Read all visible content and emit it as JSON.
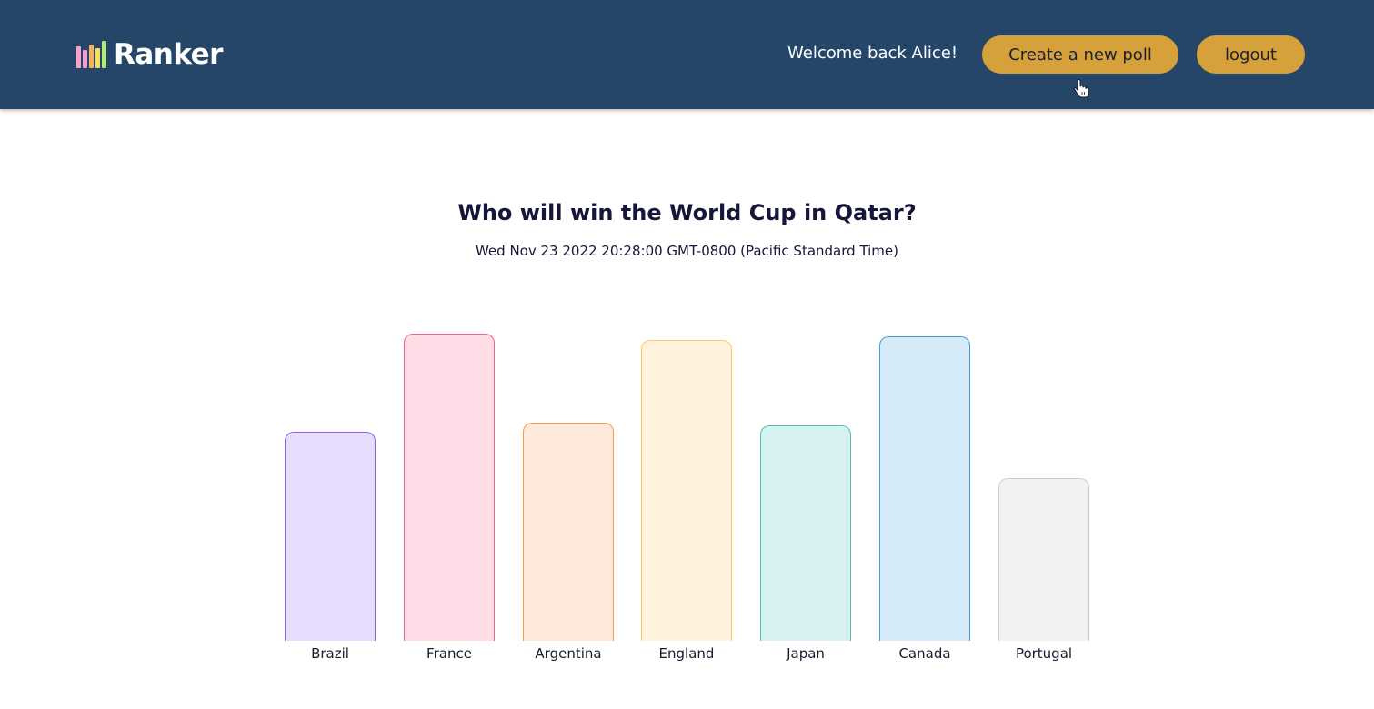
{
  "header": {
    "logo_text": "Ranker",
    "welcome": "Welcome back Alice!",
    "create_label": "Create a new poll",
    "logout_label": "logout",
    "logo_colors": [
      "#f5a3c7",
      "#f79ad0",
      "#f6b15a",
      "#f6df5c",
      "#b4e87a"
    ]
  },
  "poll": {
    "title": "Who will win the World Cup in Qatar?",
    "date": "Wed Nov 23 2022 20:28:00 GMT-0800 (Pacific Standard Time)"
  },
  "chart_data": {
    "type": "bar",
    "categories": [
      "Brazil",
      "France",
      "Argentina",
      "England",
      "Japan",
      "Canada",
      "Portugal"
    ],
    "values": [
      0.68,
      1.0,
      0.71,
      0.98,
      0.7,
      0.99,
      0.53
    ],
    "fills": [
      "#e6ddfc",
      "#ffdde6",
      "#fee9da",
      "#fff3de",
      "#d8f1f1",
      "#d6ebf8",
      "#f2f2f2"
    ],
    "strokes": [
      "#8a5cf0",
      "#f06384",
      "#f59c4a",
      "#f8c95a",
      "#4bc0c0",
      "#3b9ee8",
      "#c9cbcf"
    ]
  }
}
